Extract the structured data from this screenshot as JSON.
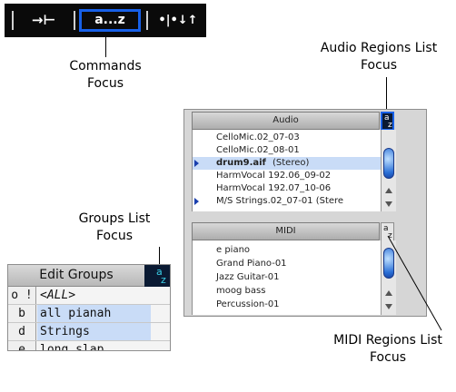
{
  "commands": {
    "buttons": [
      {
        "label": "→⊢",
        "icon": "arrow-to-boundary-icon"
      },
      {
        "label": "a...z",
        "icon": "alphabetical-sort-icon"
      },
      {
        "label": "•|•↓↑",
        "icon": "midi-note-sort-icon"
      }
    ],
    "callout": [
      "Commands",
      "Focus"
    ]
  },
  "audio_regions": {
    "callout": [
      "Audio Regions List",
      "Focus"
    ],
    "header": "Audio",
    "az_key": [
      "a",
      "z"
    ],
    "rows": [
      {
        "label": "CelloMic.02_07-03",
        "bold": false,
        "selected": false,
        "triangle": false
      },
      {
        "label": "CelloMic.02_08-01",
        "bold": false,
        "selected": false,
        "triangle": false
      },
      {
        "label": "drum9.aif",
        "suffix": " (Stereo)",
        "bold": true,
        "selected": true,
        "triangle": true
      },
      {
        "label": "HarmVocal 192.06_09-02",
        "bold": false,
        "selected": false,
        "triangle": false
      },
      {
        "label": "HarmVocal 192.07_10-06",
        "bold": false,
        "selected": false,
        "triangle": false
      },
      {
        "label": "M/S Strings.02_07-01 (Stere",
        "bold": false,
        "selected": false,
        "triangle": true
      }
    ]
  },
  "midi_regions": {
    "callout": [
      "MIDI Regions List",
      "Focus"
    ],
    "header": "MIDI",
    "az_key": [
      "a",
      "z"
    ],
    "rows": [
      "e piano",
      "Grand Piano-01",
      "Jazz Guitar-01",
      "moog bass",
      "Percussion-01"
    ]
  },
  "groups": {
    "callout": [
      "Groups List",
      "Focus"
    ],
    "header": "Edit Groups",
    "az_key": [
      "a",
      "z"
    ],
    "rows": [
      {
        "key": "o !",
        "name": "<ALL>",
        "selected": false
      },
      {
        "key": "b",
        "name": "all pianah",
        "selected": true
      },
      {
        "key": "d",
        "name": "Strings",
        "selected": true
      },
      {
        "key": "e",
        "name": "long slap",
        "selected": false
      }
    ]
  },
  "colors": {
    "focus_outline": "#1760e8",
    "selection": "#c9dcf7",
    "toolbar_bg": "#0a0a0a"
  }
}
